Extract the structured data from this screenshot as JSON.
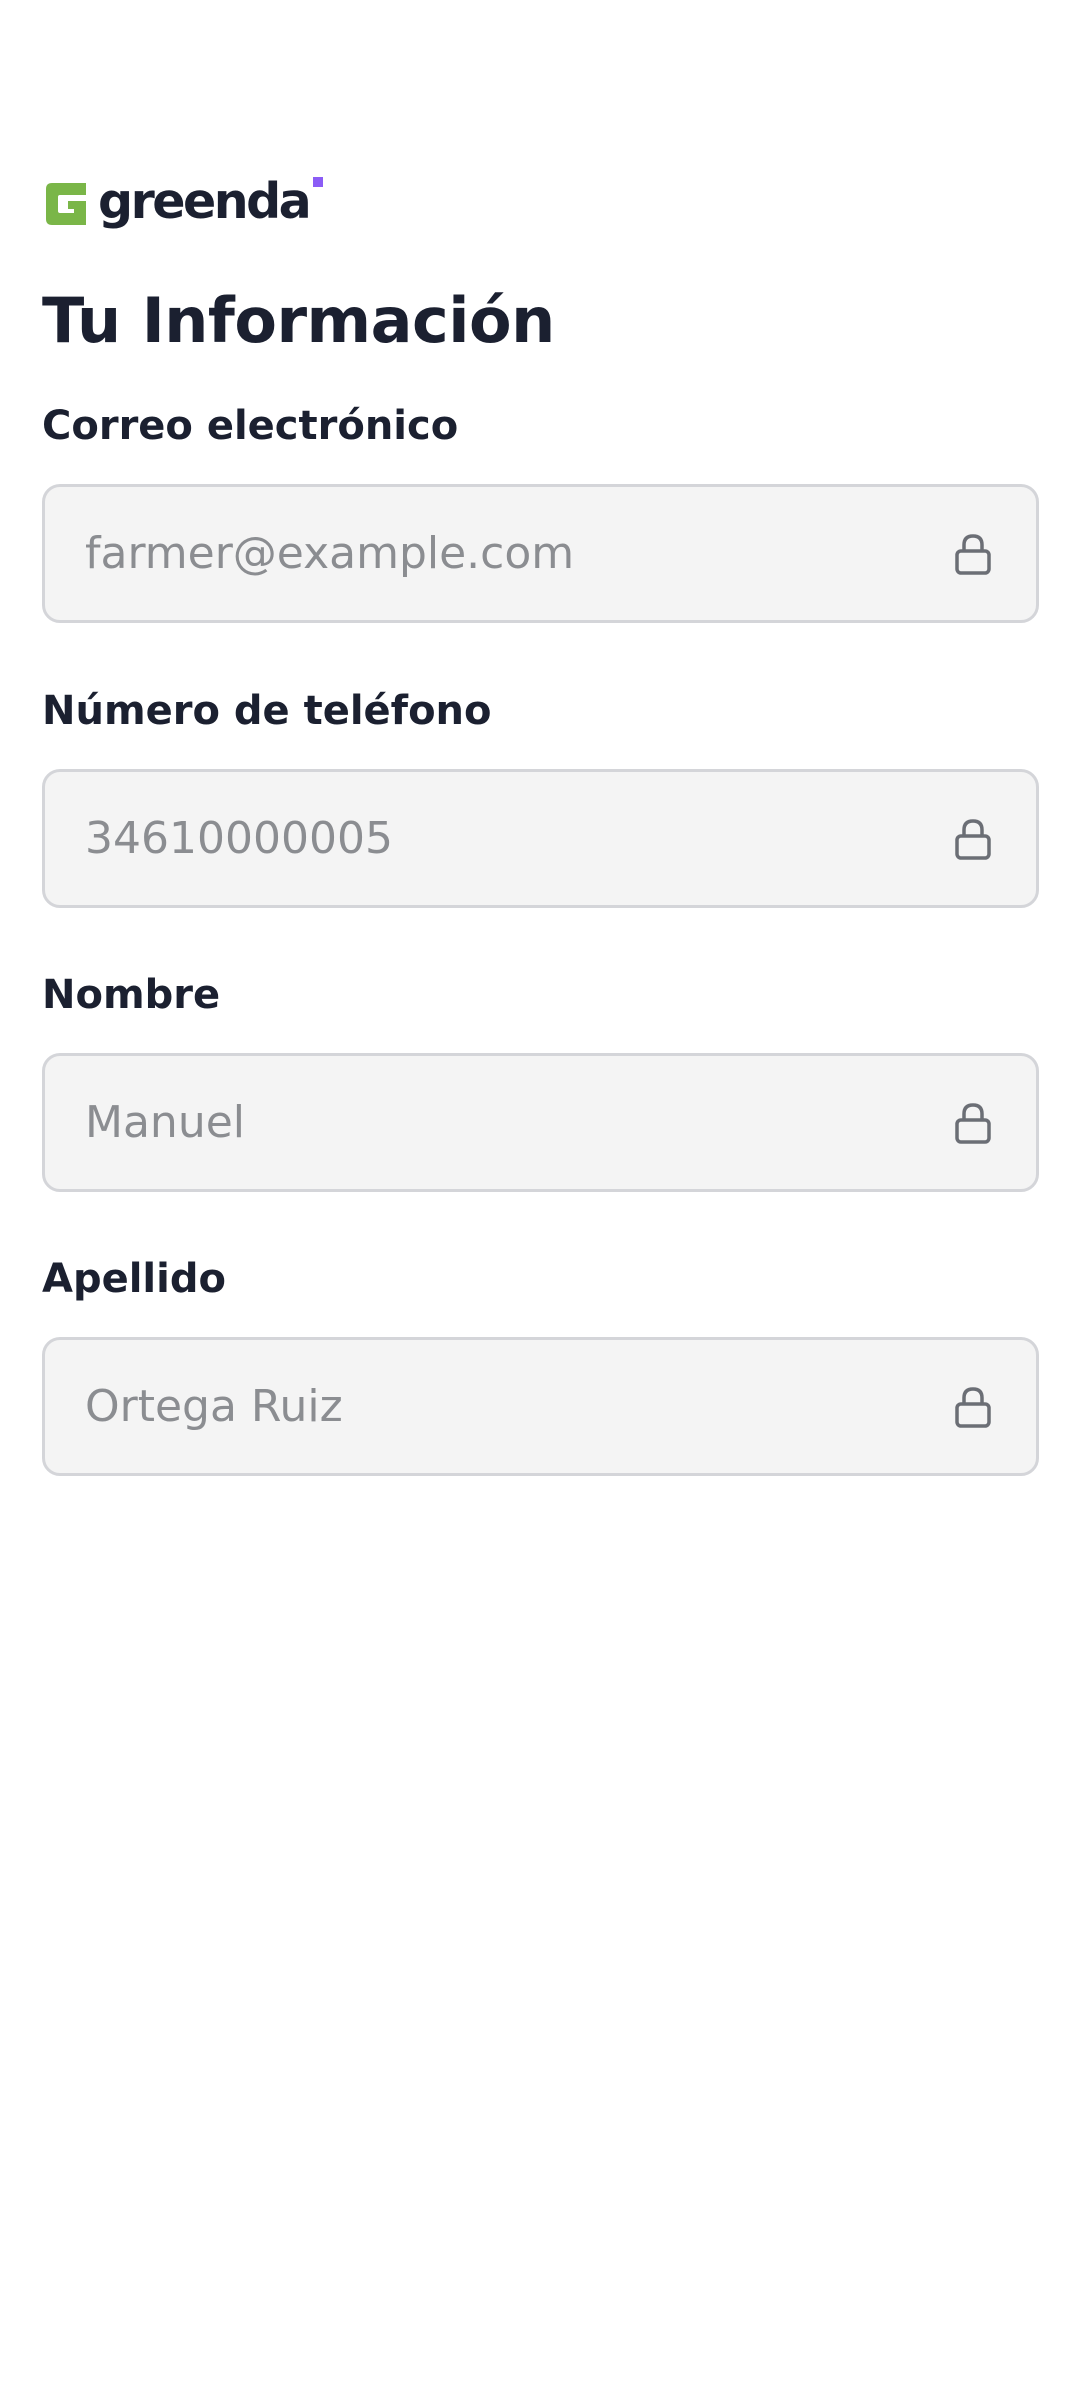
{
  "brand": {
    "name": "greenda",
    "logo_icon": "greenda-g-mark-icon",
    "logo_color": "#7ab648",
    "dot_color": "#8b5cf6"
  },
  "page": {
    "title": "Tu Información"
  },
  "fields": {
    "email": {
      "label": "Correo electrónico",
      "placeholder": "farmer@example.com",
      "icon": "lock-icon"
    },
    "phone": {
      "label": "Número de teléfono",
      "placeholder": "34610000005",
      "icon": "lock-icon"
    },
    "first_name": {
      "label": "Nombre",
      "placeholder": "Manuel",
      "icon": "lock-icon"
    },
    "last_name": {
      "label": "Apellido",
      "placeholder": "Ortega Ruiz",
      "icon": "lock-icon"
    }
  },
  "colors": {
    "text_primary": "#1b2030",
    "field_background": "#f4f4f4",
    "field_border": "#d4d5d9",
    "field_text": "#8b8d91",
    "icon": "#6b6e75"
  }
}
